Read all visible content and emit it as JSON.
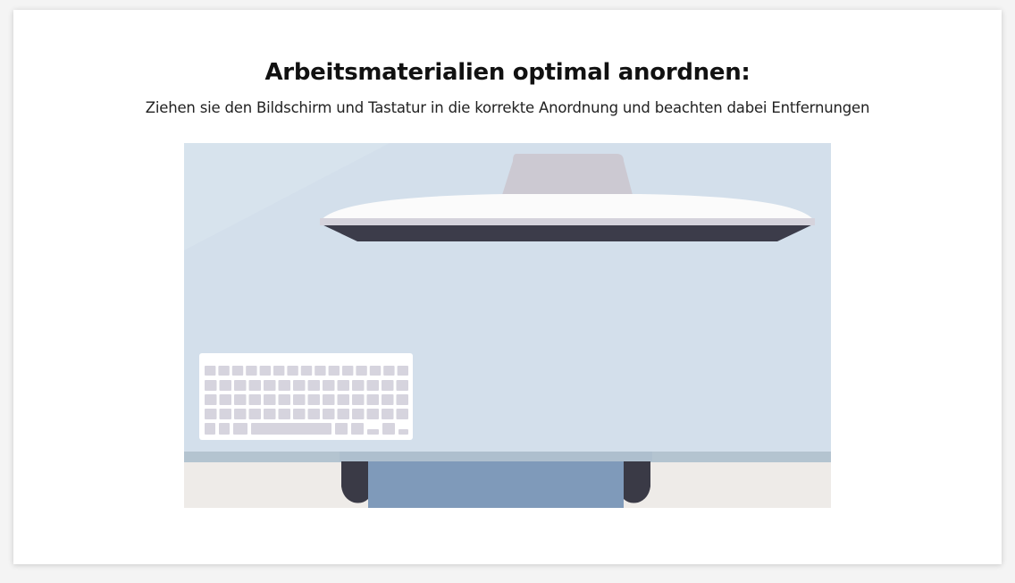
{
  "page": {
    "title": "Arbeitsmaterialien optimal anordnen:",
    "subtitle": "Ziehen sie den Bildschirm und Tastatur in die korrekte Anordnung und beachten dabei Entfernungen"
  },
  "scene": {
    "desk_color": "#d3dfeb",
    "floor_color": "#eeebe8",
    "desk_edge_color": "#b4c4d0",
    "chair_color": "#3a3a46",
    "seat_color": "#7f9aba",
    "monitor_color": "#fbfbfb",
    "monitor_shadow_color": "#3c3c4a",
    "monitor_stand_color": "#ccc9d2",
    "keyboard_color": "#ffffff",
    "key_color": "#d6d4de",
    "draggables": [
      "monitor",
      "keyboard"
    ]
  }
}
